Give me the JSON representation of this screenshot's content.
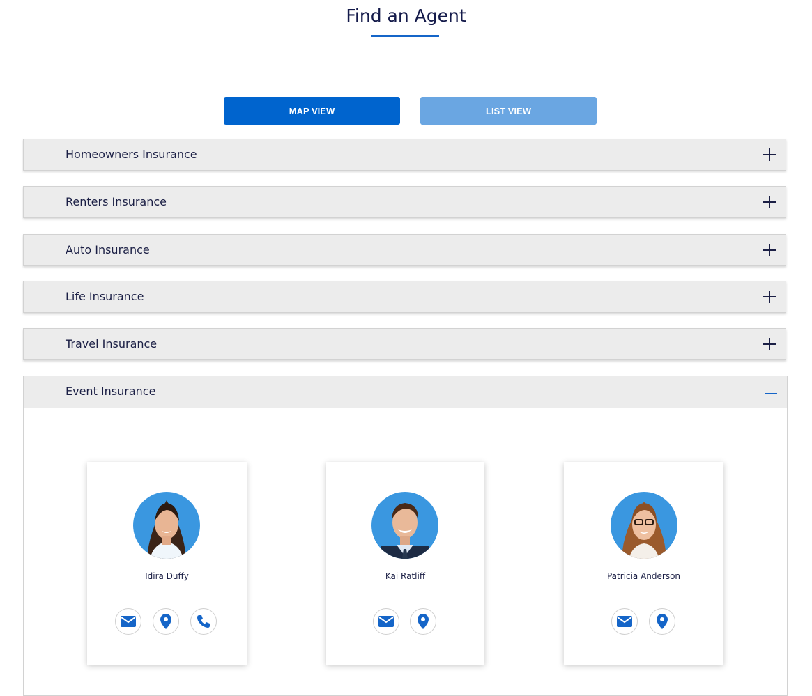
{
  "page": {
    "title": "Find an Agent"
  },
  "view_toggle": {
    "map_label": "MAP VIEW",
    "list_label": "LIST VIEW"
  },
  "accordion": [
    {
      "label": "Homeowners Insurance",
      "expanded": false
    },
    {
      "label": "Renters Insurance",
      "expanded": false
    },
    {
      "label": "Auto Insurance",
      "expanded": false
    },
    {
      "label": "Life Insurance",
      "expanded": false
    },
    {
      "label": "Travel Insurance",
      "expanded": false
    },
    {
      "label": "Event Insurance",
      "expanded": true
    }
  ],
  "agents": [
    {
      "name": "Idira Duffy",
      "actions": [
        "email-icon",
        "location-pin-icon",
        "phone-icon"
      ]
    },
    {
      "name": "Kai Ratliff",
      "actions": [
        "email-icon",
        "location-pin-icon"
      ]
    },
    {
      "name": "Patricia Anderson",
      "actions": [
        "email-icon",
        "location-pin-icon"
      ]
    }
  ],
  "colors": {
    "primary": "#0064ce",
    "primary_light": "#6aa6e2",
    "avatar_bg": "#3a97e0",
    "text_dark": "#1b1f45"
  }
}
